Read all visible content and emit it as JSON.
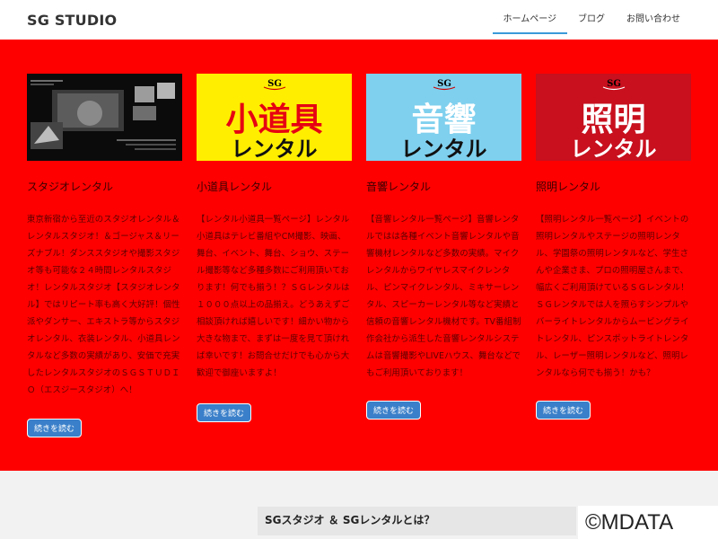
{
  "header": {
    "logo": "SG STUDIO",
    "nav": [
      {
        "label": "ホームページ",
        "active": true
      },
      {
        "label": "ブログ",
        "active": false
      },
      {
        "label": "お問い合わせ",
        "active": false
      }
    ]
  },
  "colors": {
    "section_bg": "#ff0000",
    "button_bg": "#3a7fc9",
    "nav_active": "#3a9ad9"
  },
  "cards": [
    {
      "image": {
        "icon": "studio-photo",
        "caption": "Studio Rental Photo"
      },
      "title": "スタジオレンタル",
      "text": "東京新宿から至近のスタジオレンタル＆レンタルスタジオ！＆ゴージャス＆リーズナブル！ダンススタジオや撮影スタジオ等も可能な２４時間レンタルスタジオ！レンタルスタジオ【スタジオレンタル】ではリピート率も高く大好評！個性派やダンサー、エキストラ等からスタジオレンタル、衣装レンタル、小道具レンタルなど多数の実績があり、安価で充実したレンタルスタジオのＳＧＳＴＵＤＩＯ（エスジースタジオ）へ！",
      "button": "続きを読む"
    },
    {
      "image": {
        "icon": "sg-logo",
        "line1": "小道具",
        "line2": "レンタル"
      },
      "title": "小道具レンタル",
      "text": "【レンタル小道具一覧ページ】レンタル小道具はテレビ番組やCM撮影、映画、舞台、イベント、舞台、ショウ、ステール撮影等など多種多数にご利用頂いております！何でも揃う！？ＳＧレンタルは１０００点以上の品揃え。どうあえずご相談頂ければ嬉しいです！細かい物から大きな物まで、まずは一度を見て頂ければ幸いです！お問合せだけでも心から大歓迎で御座いますよ！",
      "button": "続きを読む"
    },
    {
      "image": {
        "icon": "sg-logo",
        "line1": "音響",
        "line2": "レンタル"
      },
      "title": "音響レンタル",
      "text": "【音響レンタル一覧ページ】音響レンタルではは各種イベント音響レンタルや音響機材レンタルなど多数の実績。マイクレンタルからワイヤレスマイクレンタル、ピンマイクレンタル、ミキサーレンタル、スピーカーレンタル等など実績と信頼の音響レンタル機材です。TV番組制作会社から派生した音響レンタルシステムは音響撮影やLIVEハウス、舞台などでもご利用頂いております！",
      "button": "続きを読む"
    },
    {
      "image": {
        "icon": "sg-logo",
        "line1": "照明",
        "line2": "レンタル"
      },
      "title": "照明レンタル",
      "text": "【照明レンタル一覧ページ】イベントの照明レンタルやステージの照明レンタル、学園祭の照明レンタルなど、学生さんや企業さま、プロの照明屋さんまで、幅広くご利用頂けているＳＧレンタル！ＳＧレンタルでは人を照らすシンプルやバーライトレンタルからムービングライトレンタル、ピンスポットライトレンタル、レーザー照明レンタルなど、照明レンタルなら何でも揃う！かも？",
      "button": "続きを読む"
    }
  ],
  "about": {
    "title": "SGスタジオ ＆ SGレンタルとは？"
  },
  "watermark": "©MDATA"
}
